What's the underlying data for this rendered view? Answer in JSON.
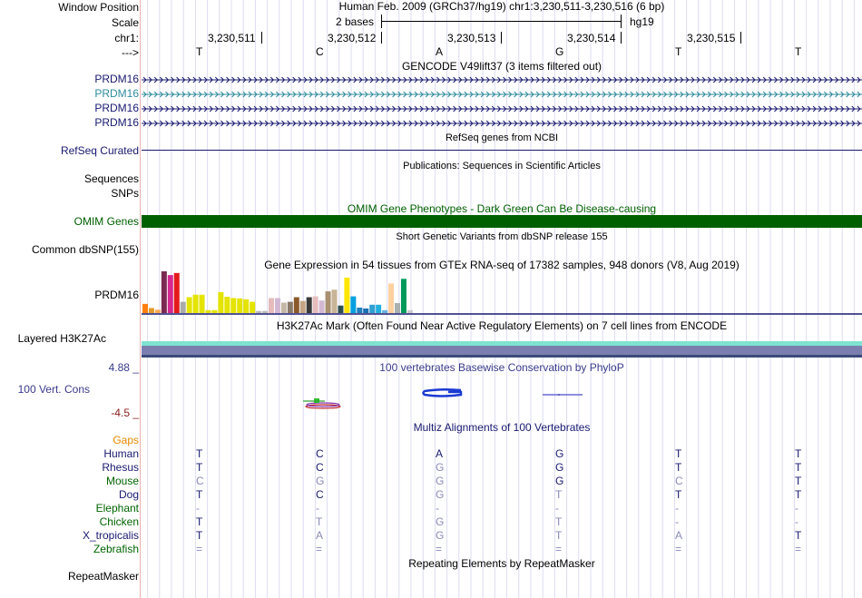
{
  "labels": {
    "window_position": "Window Position",
    "scale": "Scale",
    "chr": "chr1:",
    "strand": "--->",
    "prdm16": [
      "PRDM16",
      "PRDM16",
      "PRDM16",
      "PRDM16"
    ],
    "refseq": "RefSeq Curated",
    "sequences": "Sequences",
    "snps": "SNPs",
    "omim": "OMIM Genes",
    "dbsnp": "Common dbSNP(155)",
    "gtex_gene": "PRDM16",
    "h3k27ac": "Layered H3K27Ac",
    "cons_max": "4.88 _",
    "cons_label": "100 Vert. Cons",
    "cons_min": "-4.5 _",
    "gaps": "Gaps",
    "species": [
      "Human",
      "Rhesus",
      "Mouse",
      "Dog",
      "Elephant",
      "Chicken",
      "X_tropicalis",
      "Zebrafish"
    ],
    "repeatmasker": "RepeatMasker"
  },
  "header": {
    "assembly_position": "Human Feb. 2009 (GRCh37/hg19)   chr1:3,230,511-3,230,516 (6 bp)",
    "scale_text": "2 bases",
    "scale_db": "hg19",
    "coords": [
      "3,230,511",
      "3,230,512",
      "3,230,513",
      "3,230,514",
      "3,230,515"
    ],
    "bases": [
      "T",
      "C",
      "A",
      "G",
      "T",
      "T"
    ]
  },
  "tracks": {
    "gencode_title": "GENCODE V49lift37 (3 items filtered out)",
    "refseq_title": "RefSeq genes from NCBI",
    "publications_title": "Publications: Sequences in Scientific Articles",
    "omim_title": "OMIM Gene Phenotypes - Dark Green Can Be Disease-causing",
    "dbsnp_title": "Short Genetic Variants from dbSNP release 155",
    "gtex_title": "Gene Expression in 54 tissues from GTEx RNA-seq of 17382 samples, 948 donors (V8, Aug 2019)",
    "h3k27ac_title": "H3K27Ac Mark (Often Found Near Active Regulatory Elements) on 7 cell lines from ENCODE",
    "phylop_title": "100 vertebrates Basewise Conservation by PhyloP",
    "multiz_title": "Multiz Alignments of 100 Vertebrates",
    "repeat_title": "Repeating Elements by RepeatMasker"
  },
  "alignment": {
    "Human": [
      "T",
      "C",
      "A",
      "G",
      "T",
      "T"
    ],
    "Rhesus": [
      "T",
      "C",
      "G",
      "G",
      "T",
      "T"
    ],
    "Mouse": [
      "C",
      "G",
      "G",
      "G",
      "C",
      "T"
    ],
    "Dog": [
      "T",
      "C",
      "G",
      "T",
      "T",
      "T"
    ],
    "Elephant": [
      "-",
      "-",
      "-",
      "-",
      "-",
      "-"
    ],
    "Chicken": [
      "T",
      "T",
      "G",
      "T",
      "-",
      "-"
    ],
    "X_tropicalis": [
      "T",
      "A",
      "G",
      "T",
      "A",
      "T"
    ],
    "Zebrafish": [
      "=",
      "=",
      "=",
      "=",
      "=",
      "="
    ]
  },
  "colors": {
    "label_blue": "#191970",
    "gencode_cyan": "#2e8b9a",
    "omim_green": "#006000",
    "gaps_orange": "#e58a00",
    "species_green": "#006400",
    "cons_red": "#8b1a1a",
    "phylop_blue": "#3a3a8c",
    "grid": "#dcdcf0"
  },
  "gtex_bars": [
    {
      "v": 0.22,
      "c": "#ff7f0e"
    },
    {
      "v": 0.12,
      "c": "#e39a2c"
    },
    {
      "v": 0.08,
      "c": "#ffaa55"
    },
    {
      "v": 1.0,
      "c": "#7a2a52"
    },
    {
      "v": 0.91,
      "c": "#d62790"
    },
    {
      "v": 0.96,
      "c": "#e41a1c"
    },
    {
      "v": 0.27,
      "c": "#aaaaaa"
    },
    {
      "v": 0.38,
      "c": "#e4e400"
    },
    {
      "v": 0.44,
      "c": "#e4e400"
    },
    {
      "v": 0.44,
      "c": "#e4e400"
    },
    {
      "v": 0.07,
      "c": "#e4e400"
    },
    {
      "v": 0.07,
      "c": "#e4e400"
    },
    {
      "v": 0.5,
      "c": "#e4e400"
    },
    {
      "v": 0.39,
      "c": "#e4e400"
    },
    {
      "v": 0.36,
      "c": "#e4e400"
    },
    {
      "v": 0.35,
      "c": "#e4e400"
    },
    {
      "v": 0.33,
      "c": "#e4e400"
    },
    {
      "v": 0.27,
      "c": "#e4e400"
    },
    {
      "v": 0.05,
      "c": "#bbbbbb"
    },
    {
      "v": 0.05,
      "c": "#bbbbbb"
    },
    {
      "v": 0.36,
      "c": "#e6bcbc"
    },
    {
      "v": 0.36,
      "c": "#d3b8d3"
    },
    {
      "v": 0.25,
      "c": "#c4b7a6"
    },
    {
      "v": 0.27,
      "c": "#8a7a6a"
    },
    {
      "v": 0.38,
      "c": "#8b5a2b"
    },
    {
      "v": 0.29,
      "c": "#c4a484"
    },
    {
      "v": 0.38,
      "c": "#3a3a3a"
    },
    {
      "v": 0.4,
      "c": "#e6bcbc"
    },
    {
      "v": 0.3,
      "c": "#d3b8d3"
    },
    {
      "v": 0.52,
      "c": "#a89070"
    },
    {
      "v": 0.56,
      "c": "#c8b496"
    },
    {
      "v": 0.18,
      "c": "#2f4f4f"
    },
    {
      "v": 0.85,
      "c": "#ffe600"
    },
    {
      "v": 0.4,
      "c": "#00a0e0"
    },
    {
      "v": 0.13,
      "c": "#2080c0"
    },
    {
      "v": 0.11,
      "c": "#1a70b0"
    },
    {
      "v": 0.2,
      "c": "#30a0d0"
    },
    {
      "v": 0.2,
      "c": "#20b0e0"
    },
    {
      "v": 0.07,
      "c": "#6ab0e0"
    },
    {
      "v": 0.71,
      "c": "#ffd0a0"
    },
    {
      "v": 0.24,
      "c": "#aab0b0"
    },
    {
      "v": 0.82,
      "c": "#00995a"
    },
    {
      "v": 0.07,
      "c": "#cccccc"
    }
  ]
}
